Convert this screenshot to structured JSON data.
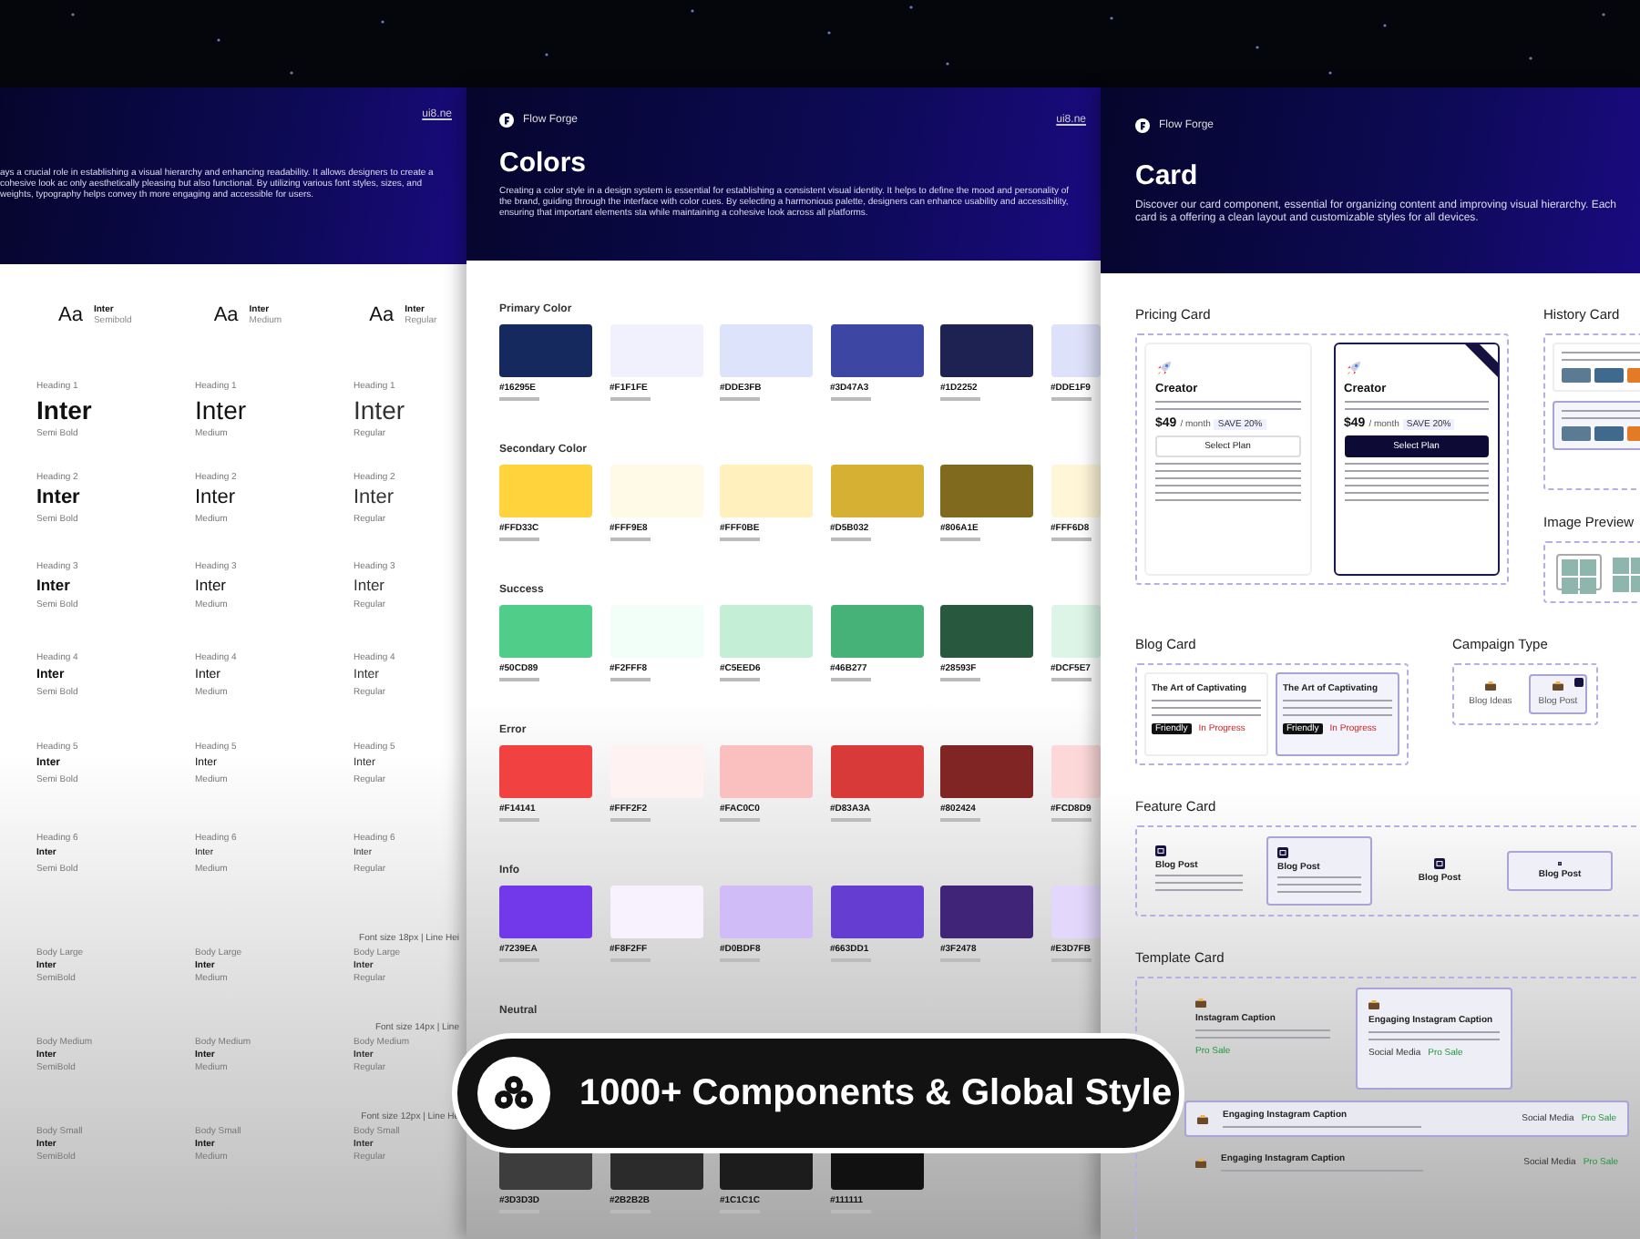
{
  "typography_page": {
    "link": "ui8.ne",
    "description": "ays a crucial role in establishing a visual hierarchy and enhancing readability. It allows designers to create a cohesive look ac only aesthetically pleasing but also functional. By utilizing various font styles, sizes, and weights, typography helps convey th more engaging and accessible for users.",
    "font_samples": [
      {
        "glyph": "Aa",
        "name": "Inter",
        "weight": "Semibold"
      },
      {
        "glyph": "Aa",
        "name": "Inter",
        "weight": "Medium"
      },
      {
        "glyph": "Aa",
        "name": "Inter",
        "weight": "Regular"
      }
    ],
    "heading_rows": [
      {
        "cells": [
          {
            "label": "Heading 1",
            "sample": "Inter",
            "weight": "Semi Bold"
          },
          {
            "label": "Heading 1",
            "sample": "Inter",
            "weight": "Medium"
          },
          {
            "label": "Heading 1",
            "sample": "Inter",
            "weight": "Regular"
          }
        ]
      },
      {
        "cells": [
          {
            "label": "Heading 2",
            "sample": "Inter",
            "weight": "Semi Bold"
          },
          {
            "label": "Heading 2",
            "sample": "Inter",
            "weight": "Medium"
          },
          {
            "label": "Heading 2",
            "sample": "Inter",
            "weight": "Regular"
          }
        ]
      },
      {
        "cells": [
          {
            "label": "Heading 3",
            "sample": "Inter",
            "weight": "Semi Bold"
          },
          {
            "label": "Heading 3",
            "sample": "Inter",
            "weight": "Medium"
          },
          {
            "label": "Heading 3",
            "sample": "Inter",
            "weight": "Regular"
          }
        ]
      },
      {
        "cells": [
          {
            "label": "Heading 4",
            "sample": "Inter",
            "weight": "Semi Bold"
          },
          {
            "label": "Heading 4",
            "sample": "Inter",
            "weight": "Medium"
          },
          {
            "label": "Heading 4",
            "sample": "Inter",
            "weight": "Regular"
          }
        ]
      },
      {
        "cells": [
          {
            "label": "Heading 5",
            "sample": "Inter",
            "weight": "Semi Bold"
          },
          {
            "label": "Heading 5",
            "sample": "Inter",
            "weight": "Medium"
          },
          {
            "label": "Heading 5",
            "sample": "Inter",
            "weight": "Regular"
          }
        ]
      },
      {
        "cells": [
          {
            "label": "Heading 6",
            "sample": "Inter",
            "weight": "Semi Bold"
          },
          {
            "label": "Heading 6",
            "sample": "Inter",
            "weight": "Medium"
          },
          {
            "label": "Heading 6",
            "sample": "Inter",
            "weight": "Regular"
          }
        ]
      }
    ],
    "body_rows": [
      {
        "note": "Font size 18px | Line Hei",
        "cells": [
          {
            "label": "Body Large",
            "sample": "Inter",
            "weight": "SemiBold"
          },
          {
            "label": "Body Large",
            "sample": "Inter",
            "weight": "Medium"
          },
          {
            "label": "Body Large",
            "sample": "Inter",
            "weight": "Regular"
          }
        ]
      },
      {
        "note": "Font size 14px | Line",
        "cells": [
          {
            "label": "Body Medium",
            "sample": "Inter",
            "weight": "SemiBold"
          },
          {
            "label": "Body Medium",
            "sample": "Inter",
            "weight": "Medium"
          },
          {
            "label": "Body Medium",
            "sample": "Inter",
            "weight": "Regular"
          }
        ]
      },
      {
        "note": "Font size 12px | Line He",
        "cells": [
          {
            "label": "Body Small",
            "sample": "Inter",
            "weight": "SemiBold"
          },
          {
            "label": "Body Small",
            "sample": "Inter",
            "weight": "Medium"
          },
          {
            "label": "Body Small",
            "sample": "Inter",
            "weight": "Regular"
          }
        ]
      }
    ]
  },
  "colors_page": {
    "logo": "Flow Forge",
    "link": "ui8.ne",
    "title": "Colors",
    "description": "Creating a color style in a design system is essential for establishing a consistent visual identity. It helps to define the mood and personality of the brand, guiding through the interface with color cues. By selecting a harmonious palette, designers can enhance usability and accessibility, ensuring that important elements sta while maintaining a cohesive look across all platforms.",
    "groups": [
      {
        "title": "Primary Color",
        "swatches": [
          {
            "hex": "#16295E"
          },
          {
            "hex": "#F1F1FE"
          },
          {
            "hex": "#DDE3FB"
          },
          {
            "hex": "#3D47A3"
          },
          {
            "hex": "#1D2252"
          },
          {
            "hex": "#DDE1F9"
          }
        ]
      },
      {
        "title": "Secondary Color",
        "swatches": [
          {
            "hex": "#FFD33C"
          },
          {
            "hex": "#FFF9E8"
          },
          {
            "hex": "#FFF0BE"
          },
          {
            "hex": "#D5B032"
          },
          {
            "hex": "#806A1E"
          },
          {
            "hex": "#FFF6D8"
          }
        ]
      },
      {
        "title": "Success",
        "swatches": [
          {
            "hex": "#50CD89"
          },
          {
            "hex": "#F2FFF8"
          },
          {
            "hex": "#C5EED6"
          },
          {
            "hex": "#46B277"
          },
          {
            "hex": "#28593F"
          },
          {
            "hex": "#DCF5E7"
          }
        ]
      },
      {
        "title": "Error",
        "swatches": [
          {
            "hex": "#F14141"
          },
          {
            "hex": "#FFF2F2"
          },
          {
            "hex": "#FAC0C0"
          },
          {
            "hex": "#D83A3A"
          },
          {
            "hex": "#802424"
          },
          {
            "hex": "#FCD8D9"
          }
        ]
      },
      {
        "title": "Info",
        "swatches": [
          {
            "hex": "#7239EA"
          },
          {
            "hex": "#F8F2FF"
          },
          {
            "hex": "#D0BDF8"
          },
          {
            "hex": "#663DD1"
          },
          {
            "hex": "#3F2478"
          },
          {
            "hex": "#E3D7FB"
          }
        ]
      },
      {
        "title": "Neutral",
        "swatches": [
          {
            "hex": "#3D3D3D"
          },
          {
            "hex": "#2B2B2B"
          },
          {
            "hex": "#1C1C1C"
          },
          {
            "hex": "#111111"
          }
        ]
      }
    ]
  },
  "card_page": {
    "logo": "Flow Forge",
    "title": "Card",
    "description": "Discover our card component, essential for organizing content and improving visual hierarchy. Each card is a offering a clean layout and customizable styles for all devices.",
    "pricing": {
      "title": "Pricing Card",
      "plans": [
        {
          "name": "Creator",
          "price": "$49",
          "period": "/ month",
          "discount": "SAVE 20%",
          "button": "Select Plan",
          "selected": false
        },
        {
          "name": "Creator",
          "price": "$49",
          "period": "/ month",
          "discount": "SAVE 20%",
          "button": "Select Plan",
          "selected": true
        }
      ]
    },
    "history": {
      "title": "History Card",
      "items": [
        {
          "selected": false
        },
        {
          "selected": true
        }
      ]
    },
    "image_preview": {
      "title": "Image Preview"
    },
    "blog": {
      "title": "Blog Card",
      "cards": [
        {
          "title": "The Art of Captivating",
          "tag": "Friendly",
          "status": "In Progress",
          "selected": false
        },
        {
          "title": "The Art of Captivating",
          "tag": "Friendly",
          "status": "In Progress",
          "selected": true
        }
      ]
    },
    "campaign": {
      "title": "Campaign Type",
      "options": [
        {
          "label": "Blog Ideas",
          "selected": false
        },
        {
          "label": "Blog Post",
          "selected": true
        }
      ]
    },
    "feature": {
      "title": "Feature Card",
      "cards": [
        {
          "kind": "full",
          "title": "Blog Post",
          "selected": false
        },
        {
          "kind": "full",
          "title": "Blog Post",
          "selected": true
        },
        {
          "kind": "compact",
          "title": "Blog Post",
          "selected": false
        },
        {
          "kind": "compact",
          "title": "Blog Post",
          "selected": true
        }
      ]
    },
    "template": {
      "title": "Template Card",
      "tiles": [
        {
          "title": "Instagram Caption",
          "tags": [
            "Pro Sale"
          ],
          "selected": false
        },
        {
          "title": "Engaging Instagram Caption",
          "tags": [
            "Social Media",
            "Pro Sale"
          ],
          "selected": true
        }
      ],
      "rows": [
        {
          "title": "Engaging Instagram Caption",
          "tags": [
            "Social Media",
            "Pro Sale"
          ],
          "selected": true
        },
        {
          "title": "Engaging Instagram Caption",
          "tags": [
            "Social Media",
            "Pro Sale"
          ],
          "selected": false
        }
      ]
    }
  },
  "badge": {
    "text": "1000+ Components & Global Style"
  }
}
